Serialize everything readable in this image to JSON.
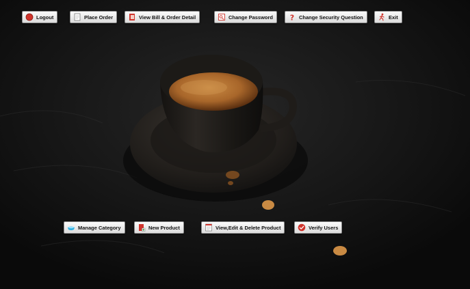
{
  "top_toolbar": {
    "logout": {
      "label": "Logout",
      "icon": "record-circle-icon"
    },
    "place_order": {
      "label": "Place Order",
      "icon": "document-icon"
    },
    "view_bill": {
      "label": "View Bill & Order Detail",
      "icon": "bill-book-icon"
    },
    "change_password": {
      "label": "Change Password",
      "icon": "password-key-icon"
    },
    "change_security": {
      "label": "Change Security Question",
      "icon": "question-mark-icon"
    },
    "exit": {
      "label": "Exit",
      "icon": "exit-running-man-icon"
    }
  },
  "admin_toolbar": {
    "manage_category": {
      "label": "Manage Category",
      "icon": "category-tray-icon"
    },
    "new_product": {
      "label": "New Product",
      "icon": "new-product-icon"
    },
    "view_edit_delete": {
      "label": "View,Edit & Delete Product",
      "icon": "edit-list-icon"
    },
    "verify_users": {
      "label": "Verify Users",
      "icon": "check-circle-icon"
    }
  },
  "colors": {
    "background": "#121212",
    "button_face": "#e6e6e6",
    "accent_red": "#d0342c",
    "coffee": "#a8662a"
  }
}
